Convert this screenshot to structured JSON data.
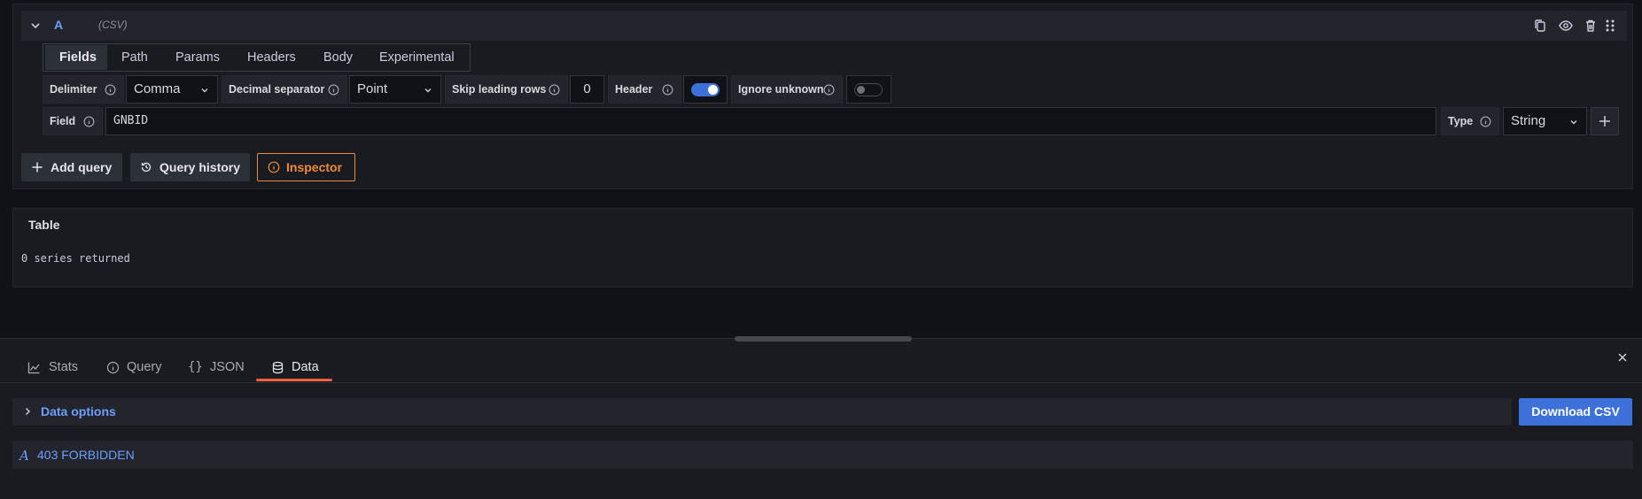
{
  "query": {
    "name": "A",
    "type": "(CSV)",
    "tabs": [
      "Fields",
      "Path",
      "Params",
      "Headers",
      "Body",
      "Experimental"
    ],
    "active_tab": "Fields",
    "options": {
      "delimiter_label": "Delimiter",
      "delimiter_value": "Comma",
      "decimal_label": "Decimal separator",
      "decimal_value": "Point",
      "skip_label": "Skip leading rows",
      "skip_value": "0",
      "header_label": "Header",
      "header_on": true,
      "ignore_label": "Ignore unknown",
      "ignore_on": false
    },
    "field": {
      "label": "Field",
      "value": "GNBID",
      "type_label": "Type",
      "type_value": "String"
    }
  },
  "actions": {
    "add_query": "Add query",
    "query_history": "Query history",
    "inspector": "Inspector"
  },
  "table": {
    "title": "Table",
    "status": "0 series returned"
  },
  "inspector": {
    "tabs": [
      "Stats",
      "Query",
      "JSON",
      "Data"
    ],
    "active_tab": "Data",
    "data_options": "Data options",
    "download": "Download CSV",
    "frame_name": "403 FORBIDDEN"
  },
  "colors": {
    "accent_blue": "#6e9fff",
    "primary_button": "#3d71d9",
    "inspector_orange": "#f08a3a",
    "tab_underline": "#f55f3e"
  },
  "icons": [
    "chevron-down-icon",
    "copy-icon",
    "eye-icon",
    "trash-icon",
    "drag-icon",
    "info-icon",
    "plus-icon",
    "history-icon",
    "graph-icon",
    "braces-icon",
    "database-icon",
    "close-icon",
    "chevron-right-icon",
    "text-frame-icon"
  ]
}
